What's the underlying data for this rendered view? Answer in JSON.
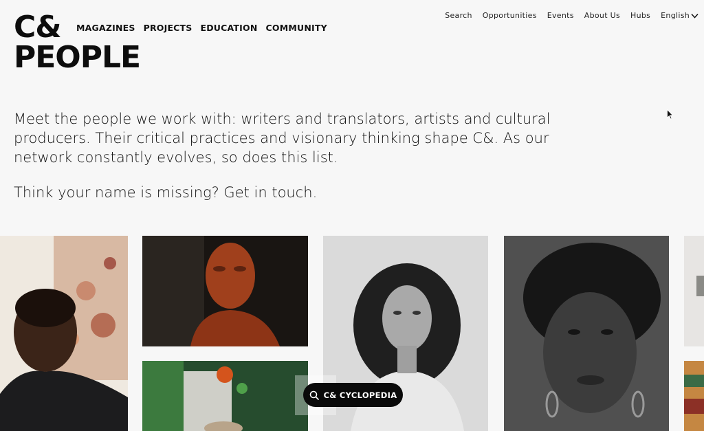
{
  "logo": {
    "line1": "C&",
    "line2": "PEOPLE"
  },
  "main_nav": [
    {
      "label": "MAGAZINES"
    },
    {
      "label": "PROJECTS"
    },
    {
      "label": "EDUCATION"
    },
    {
      "label": "COMMUNITY"
    }
  ],
  "top_nav": {
    "search": "Search",
    "opportunities": "Opportunities",
    "events": "Events",
    "about": "About Us",
    "hubs": "Hubs",
    "language": "English"
  },
  "intro": {
    "paragraph1": "Meet the people we work with: writers and translators, artists and cultural producers. Their critical practices and visionary thinking shape C&. As our network constantly evolves, so does this list.",
    "paragraph2": "Think your name is missing? Get in touch."
  },
  "cyclopedia_button": {
    "label": "C& CYCLOPEDIA",
    "icon": "search-icon"
  },
  "colors": {
    "background": "#f7f7f7",
    "text": "#111111",
    "button": "#0a0a0a"
  }
}
